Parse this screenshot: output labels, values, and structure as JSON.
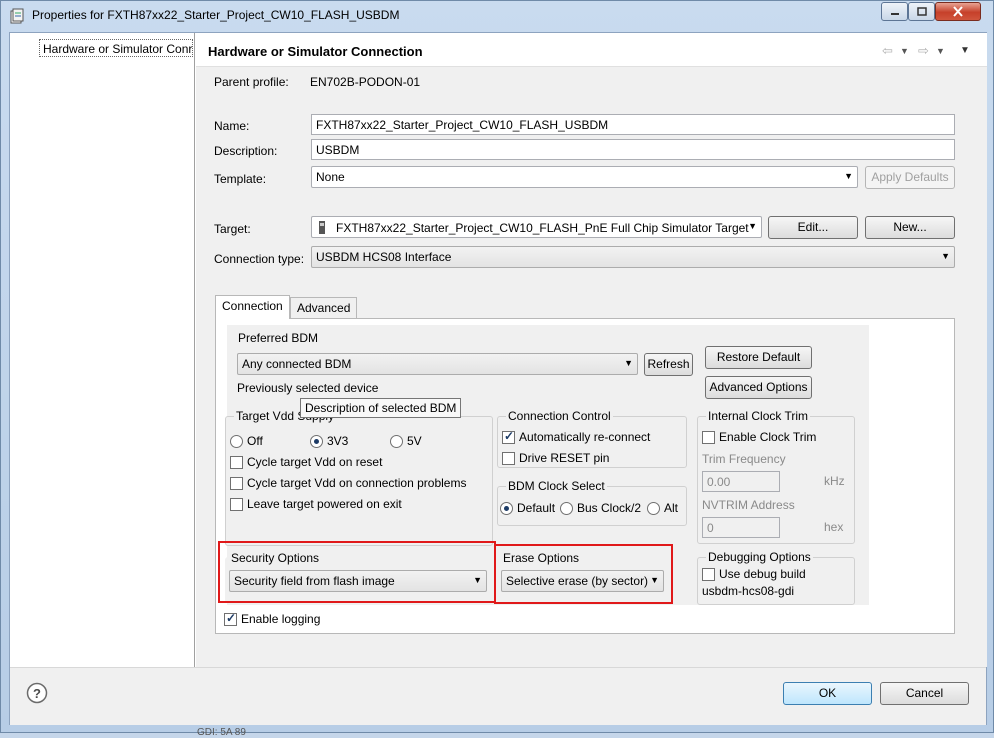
{
  "window": {
    "title": "Properties for FXTH87xx22_Starter_Project_CW10_FLASH_USBDM"
  },
  "left_pane": {
    "tree_item": "Hardware or Simulator Conr"
  },
  "page": {
    "title": "Hardware or Simulator Connection",
    "parent_profile_label": "Parent profile:",
    "parent_profile_value": "EN702B-PODON-01",
    "name_label": "Name:",
    "name_value": "FXTH87xx22_Starter_Project_CW10_FLASH_USBDM",
    "description_label": "Description:",
    "description_value": "USBDM",
    "template_label": "Template:",
    "template_value": "None",
    "apply_defaults": "Apply Defaults",
    "target_label": "Target:",
    "target_value": "FXTH87xx22_Starter_Project_CW10_FLASH_PnE Full Chip Simulator Target",
    "edit_button": "Edit...",
    "new_button": "New...",
    "connection_type_label": "Connection type:",
    "connection_type_value": "USBDM HCS08 Interface"
  },
  "tabs": [
    "Connection",
    "Advanced"
  ],
  "connection": {
    "preferred_bdm_title": "Preferred BDM",
    "bdm_value": "Any connected BDM",
    "refresh": "Refresh",
    "previously_selected": "Previously selected device",
    "tooltip": "Description of selected BDM",
    "restore_default": "Restore Default",
    "advanced_options": "Advanced Options",
    "vdd_title": "Target Vdd Supply",
    "vdd_off": "Off",
    "vdd_3v3": "3V3",
    "vdd_5v": "5V",
    "cycle_reset": "Cycle target Vdd on reset",
    "cycle_problems": "Cycle target Vdd on connection problems",
    "leave_powered": "Leave target powered on exit",
    "conn_control_title": "Connection Control",
    "auto_reconnect": "Automatically re-connect",
    "drive_reset": "Drive RESET pin",
    "bdm_clock_title": "BDM Clock Select",
    "clock_default": "Default",
    "clock_bus": "Bus Clock/2",
    "clock_alt": "Alt",
    "clock_trim_title": "Internal Clock Trim",
    "enable_clock_trim": "Enable Clock Trim",
    "trim_freq_label": "Trim Frequency",
    "trim_freq_value": "0.00",
    "trim_freq_unit": "kHz",
    "nvtrim_label": "NVTRIM Address",
    "nvtrim_value": "0",
    "nvtrim_unit": "hex",
    "security_title": "Security Options",
    "security_value": "Security field from flash image",
    "erase_title": "Erase Options",
    "erase_value": "Selective erase (by sector)",
    "debug_title": "Debugging Options",
    "use_debug_build": "Use debug build",
    "debug_gdi": "usbdm-hcs08-gdi",
    "enable_logging": "Enable logging"
  },
  "bottom": {
    "ok": "OK",
    "cancel": "Cancel"
  },
  "background_text": "GDI: 5A 89"
}
